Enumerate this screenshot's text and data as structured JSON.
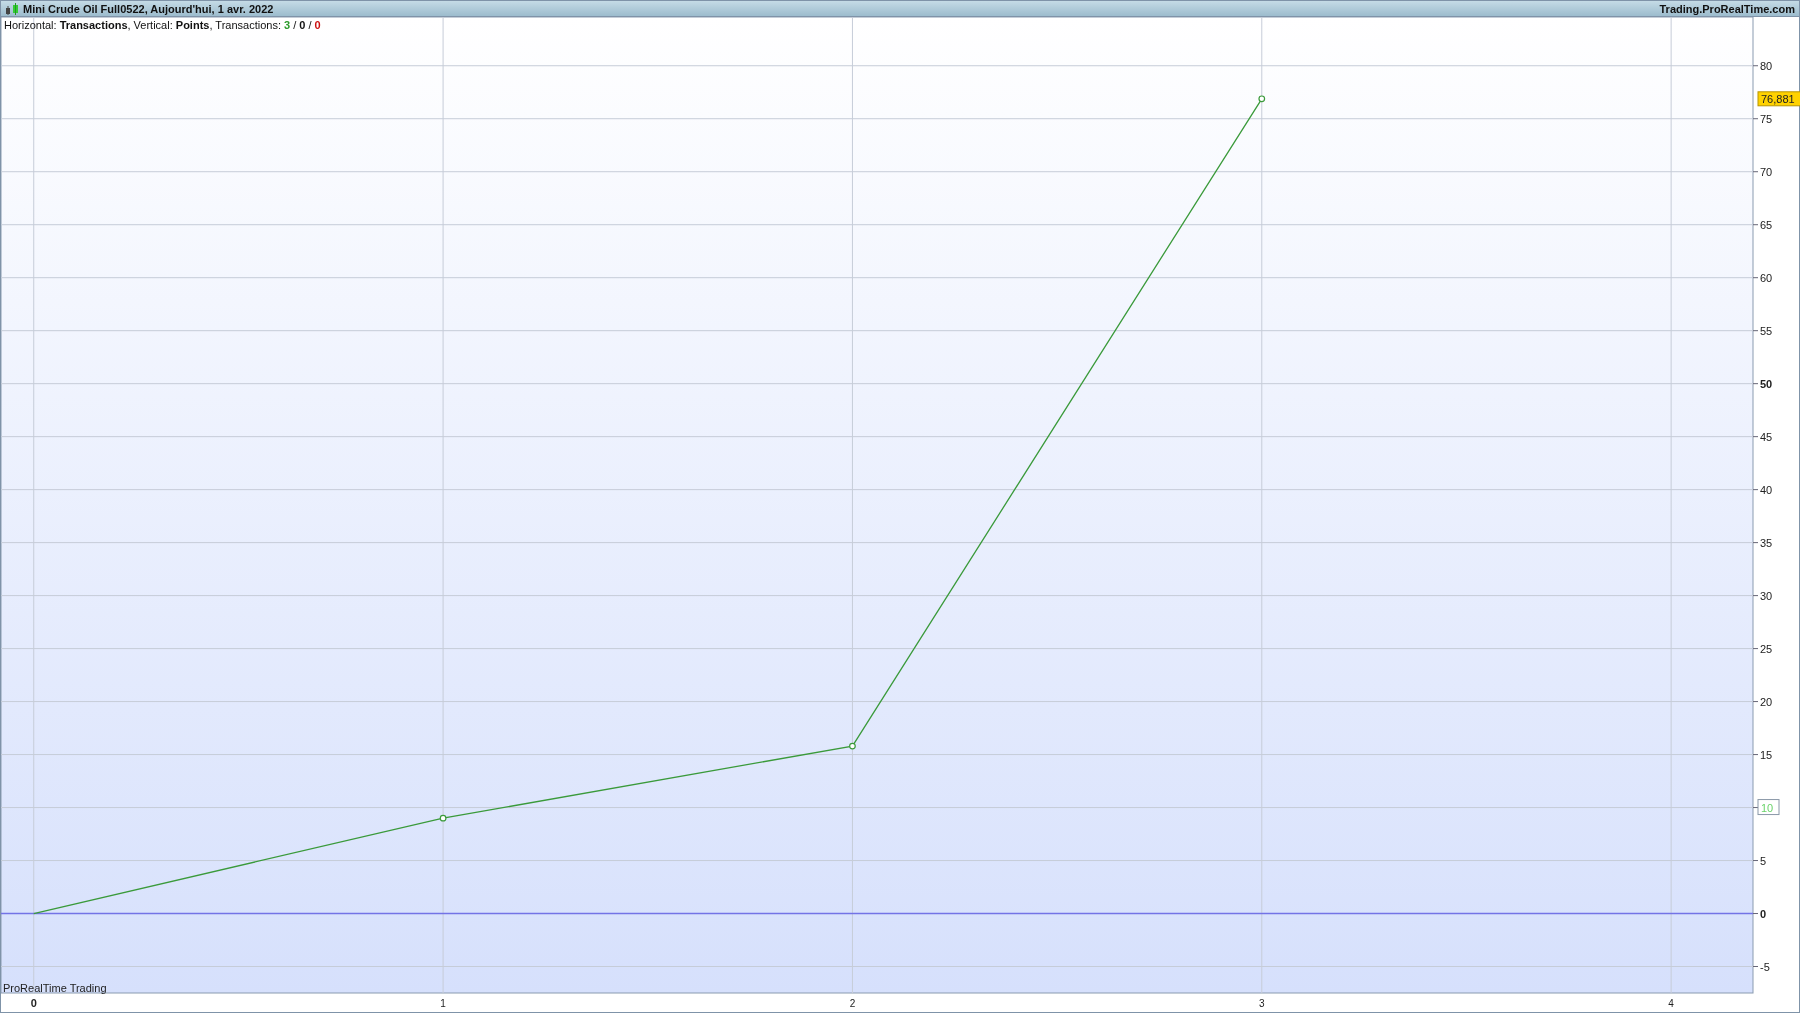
{
  "window": {
    "title": "Mini Crude Oil Full0522, Aujourd'hui, 1 avr. 2022",
    "site": "Trading.ProRealTime.com"
  },
  "info": [
    {
      "kind": "plain",
      "text": "Horizontal: "
    },
    {
      "kind": "bold",
      "text": "Transactions"
    },
    {
      "kind": "plain",
      "text": ", Vertical: "
    },
    {
      "kind": "series"
    },
    {
      "kind": "plain",
      "text": ", Transactions: "
    },
    {
      "kind": "positive",
      "text": "3"
    },
    {
      "kind": "plain",
      "text": " / "
    },
    {
      "kind": "bold",
      "text": "0"
    },
    {
      "kind": "plain",
      "text": " / "
    },
    {
      "kind": "negative",
      "text": "0"
    }
  ],
  "footer": "ProRealTime Trading",
  "chart_data": {
    "type": "line",
    "x": [
      0,
      1,
      2,
      3
    ],
    "series": [
      {
        "name": "Points",
        "color": "#3a9a3a",
        "values": [
          0,
          9,
          15.8,
          76.881
        ]
      }
    ],
    "xlim": [
      -0.08,
      4.2
    ],
    "ylim": [
      -7.5,
      84.6
    ],
    "xticks": [
      0,
      1,
      2,
      3,
      4
    ],
    "yticks": [
      -5,
      0,
      5,
      {
        "value": 10,
        "label": "10"
      },
      15,
      20,
      25,
      30,
      35,
      40,
      45,
      50,
      55,
      60,
      65,
      70,
      75,
      80
    ],
    "grid": true,
    "ref_lines": [
      {
        "axis": "y",
        "value": 0,
        "color": "#7373e6"
      }
    ],
    "annotations": [
      "76,881"
    ]
  }
}
